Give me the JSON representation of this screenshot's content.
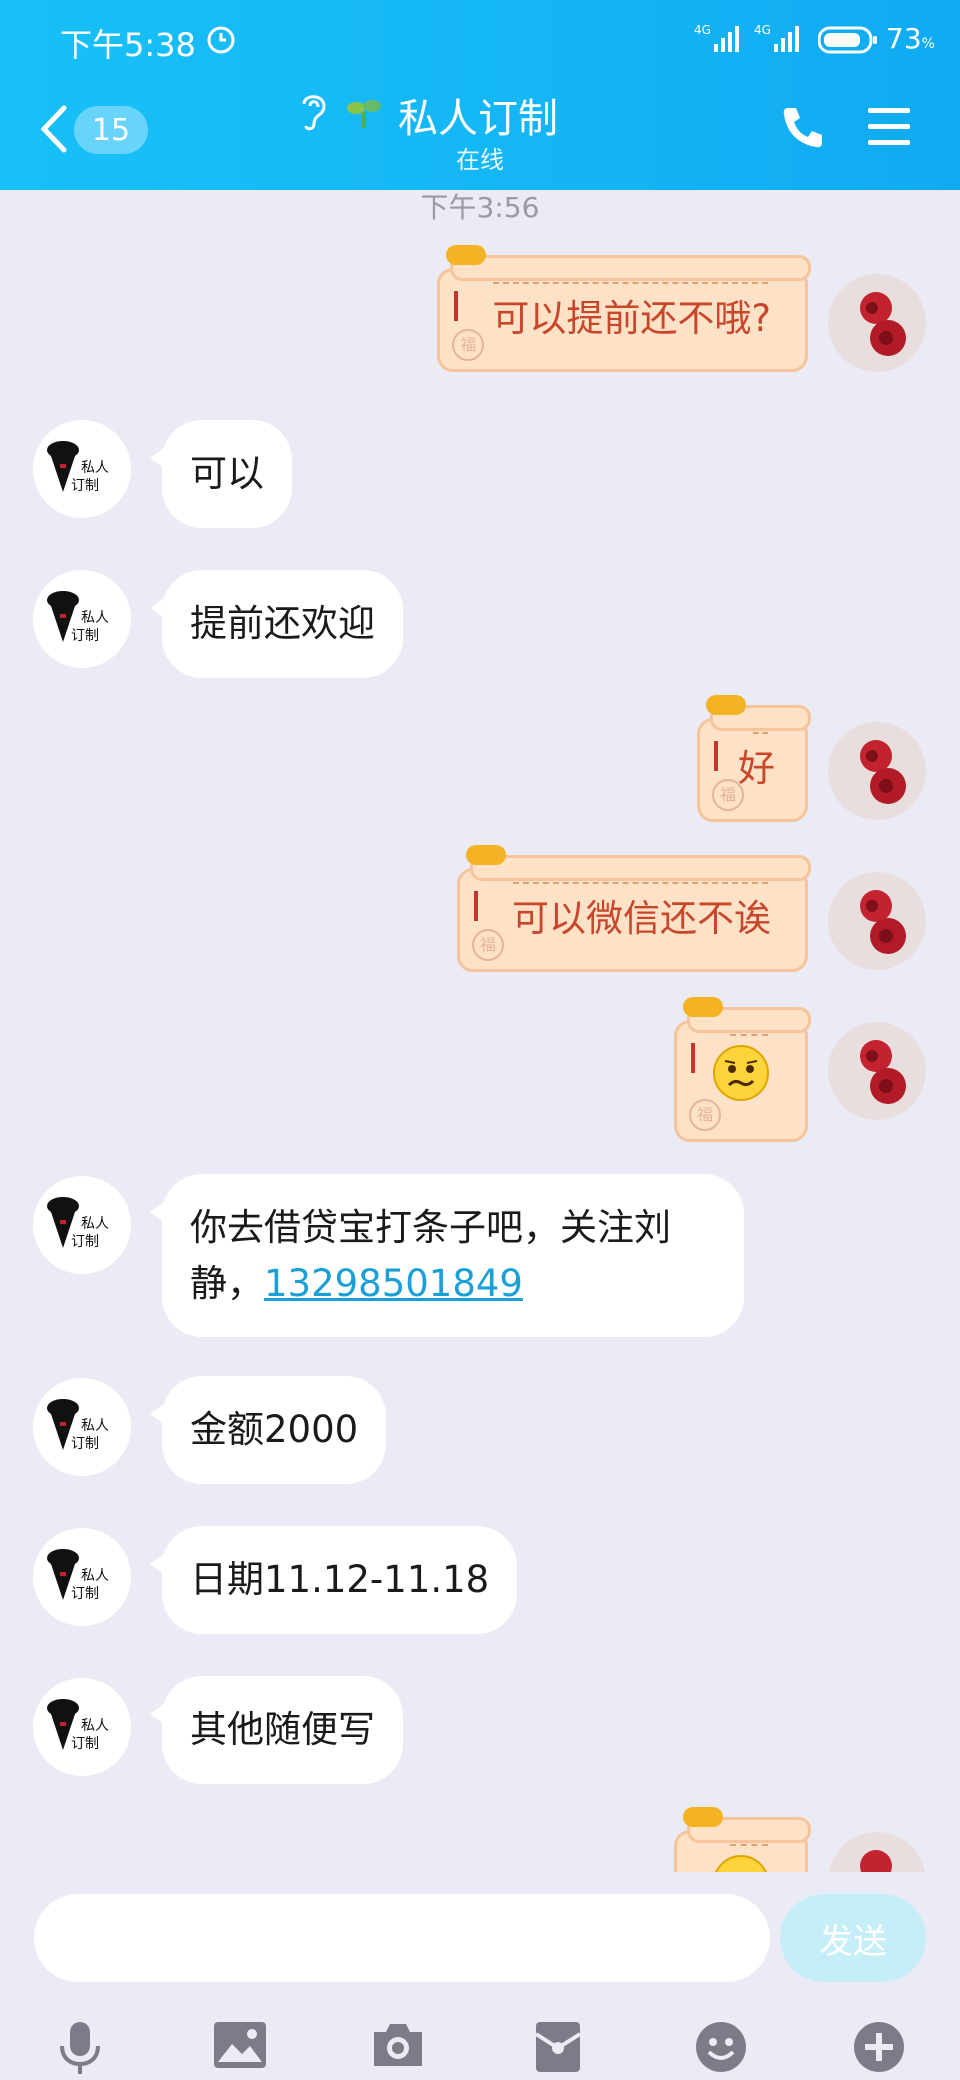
{
  "status_bar": {
    "time": "下午5:38",
    "network_1": "4G",
    "network_2": "4G",
    "battery": "73",
    "battery_unit": "%"
  },
  "header": {
    "back_badge": "15",
    "title": "私人订制",
    "subtitle": "在线"
  },
  "chat": {
    "timestamp": "下午3:56",
    "messages": [
      {
        "side": "right",
        "text": "可以提前还不哦?"
      },
      {
        "side": "left",
        "text": "可以"
      },
      {
        "side": "left",
        "text": "提前还欢迎"
      },
      {
        "side": "right",
        "text": "好"
      },
      {
        "side": "right",
        "text": "可以微信还不诶"
      },
      {
        "side": "right",
        "emoji": "sweat-smile-emoji"
      },
      {
        "side": "left",
        "text_line1": "你去借贷宝打条子吧，关注刘",
        "text_line2": "静，",
        "link": "13298501849"
      },
      {
        "side": "left",
        "text": "金额2000"
      },
      {
        "side": "left",
        "text": "日期11.12-11.18"
      },
      {
        "side": "left",
        "text": "其他随便写"
      },
      {
        "side": "right",
        "emoji": "frown-emoji"
      }
    ],
    "left_avatar_text_1": "私人",
    "left_avatar_text_2": "订制",
    "stamp_char": "福"
  },
  "input": {
    "placeholder": "",
    "send_label": "发送"
  },
  "toolbar": [
    "mic-icon",
    "image-icon",
    "camera-icon",
    "red-packet-icon",
    "emoji-icon",
    "plus-icon"
  ],
  "colors": {
    "header": "#14b6f5",
    "bubble_right": "#fde2c8",
    "bubble_right_text": "#c8472b",
    "link": "#1aa0d6",
    "background": "#ebebf5"
  }
}
